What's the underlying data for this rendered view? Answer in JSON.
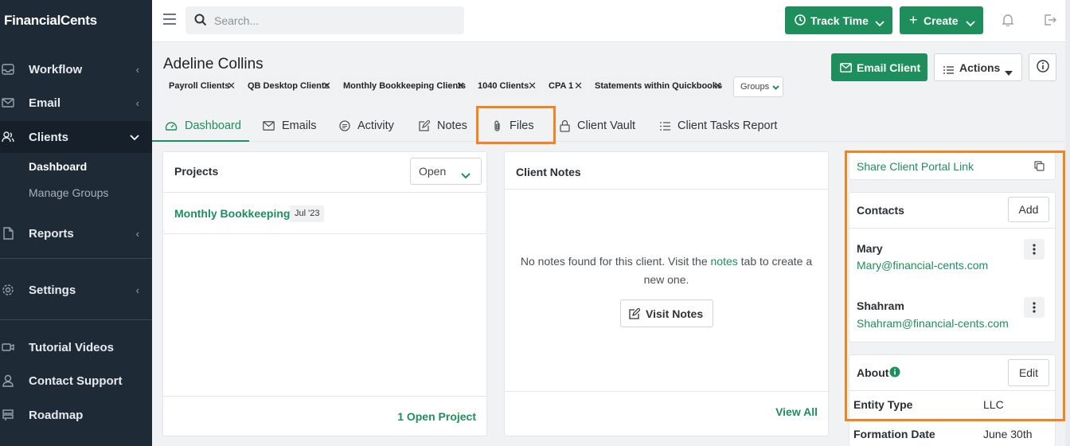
{
  "app": {
    "brand": "FinancialCents"
  },
  "sidebar": {
    "items": [
      {
        "label": "Workflow",
        "icon": "inbox-icon"
      },
      {
        "label": "Email",
        "icon": "mail-icon"
      },
      {
        "label": "Clients",
        "icon": "users-icon"
      },
      {
        "label": "Reports",
        "icon": "document-icon"
      },
      {
        "label": "Settings",
        "icon": "gear-icon"
      },
      {
        "label": "Tutorial Videos",
        "icon": "video-icon"
      },
      {
        "label": "Contact Support",
        "icon": "person-icon"
      },
      {
        "label": "Roadmap",
        "icon": "signpost-icon"
      }
    ],
    "clients_sub": [
      "Dashboard",
      "Manage Groups"
    ]
  },
  "topbar": {
    "search_placeholder": "Search...",
    "track_time": "Track Time",
    "create": "Create"
  },
  "client": {
    "name": "Adeline Collins",
    "tags": [
      "Payroll Clients",
      "QB Desktop Clients",
      "Monthly Bookkeeping Clients",
      "1040 Clients",
      "CPA 1",
      "Statements within Quickbooks"
    ],
    "groups_label": "Groups",
    "email_client": "Email Client",
    "actions": "Actions"
  },
  "tabs": [
    "Dashboard",
    "Emails",
    "Activity",
    "Notes",
    "Files",
    "Client Vault",
    "Client Tasks Report"
  ],
  "projects": {
    "title": "Projects",
    "filter": "Open",
    "items": [
      {
        "name": "Monthly Bookkeeping",
        "date": "Jul '23"
      }
    ],
    "footer": "1 Open Project"
  },
  "notes": {
    "title": "Client Notes",
    "empty_pre": "No notes found for this client. Visit the ",
    "empty_link": "notes",
    "empty_post": " tab to create a new one.",
    "visit": "Visit Notes",
    "footer": "View All"
  },
  "portal": {
    "share": "Share Client Portal Link"
  },
  "contacts": {
    "title": "Contacts",
    "add": "Add",
    "items": [
      {
        "name": "Mary",
        "email": "Mary@financial-cents.com"
      },
      {
        "name": "Shahram",
        "email": "Shahram@financial-cents.com"
      }
    ]
  },
  "about": {
    "title": "About",
    "edit": "Edit",
    "fields": [
      {
        "label": "Entity Type",
        "value": "LLC"
      },
      {
        "label": "Formation Date",
        "value": "June 30th"
      }
    ]
  },
  "colors": {
    "brand_green": "#1e8e5d",
    "highlight": "#f58220",
    "sidebar": "#1f2a37"
  }
}
